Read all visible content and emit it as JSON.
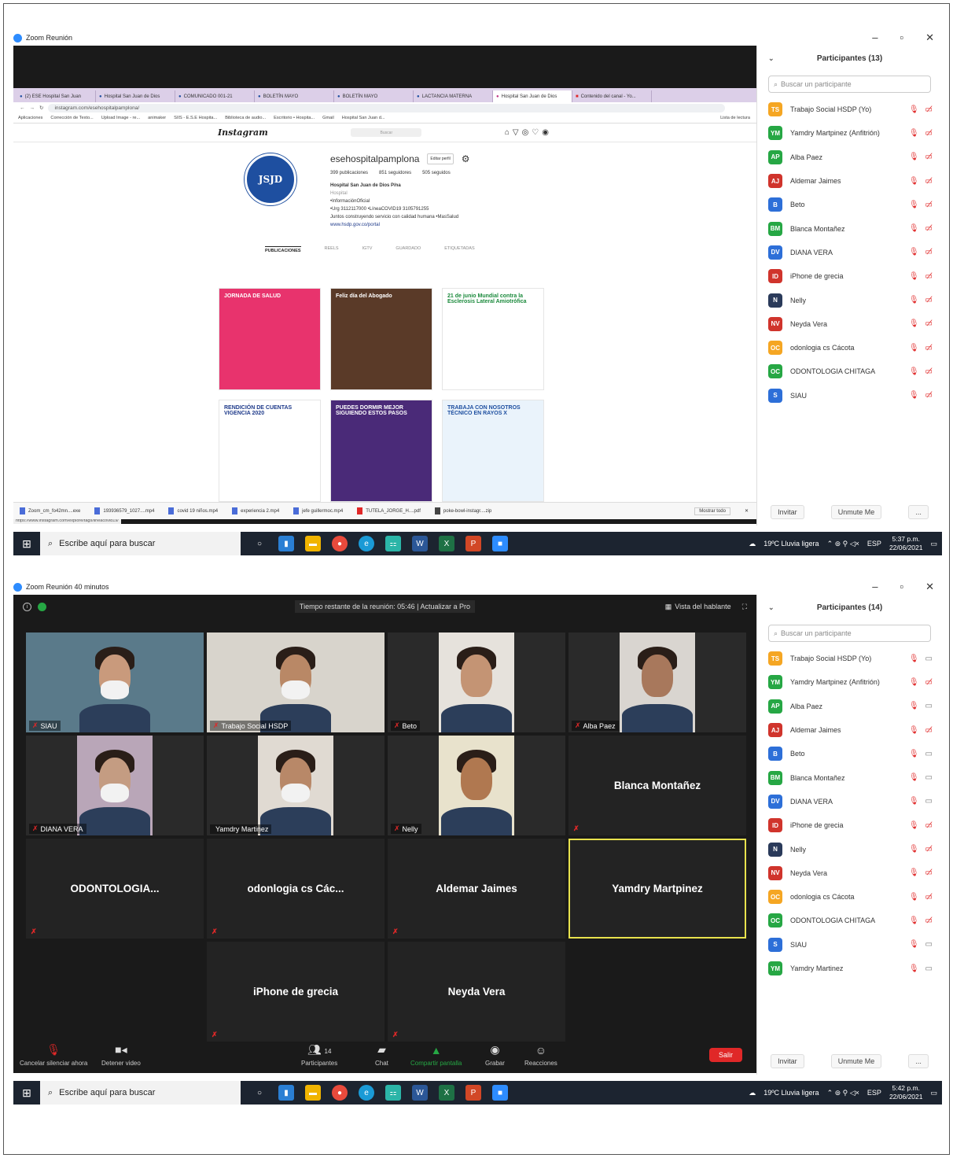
{
  "shot1": {
    "window_title": "Zoom Reunión",
    "browser": {
      "tabs": [
        "(2) ESE Hospital San Juan",
        "Hospital San Juan de Dios",
        "COMUNICADO 001-21",
        "BOLETÍN MAYO",
        "BOLETÍN MAYO",
        "LACTANCIA MATERNA",
        "Hospital San Juan de Dios",
        "Contenido del canal - Yo..."
      ],
      "url": "instagram.com/esehospitalpamplona/",
      "bookmarks": [
        "Aplicaciones",
        "Corrección de Texto...",
        "Upload Image - re...",
        "animaker",
        "SIIS - E.S.E Hospita...",
        "Biblioteca de audio...",
        "Escritorio • Hospita...",
        "Gmail",
        "Hospital San Juan d...",
        "Lista de lectura"
      ],
      "ig_logo": "Instagram",
      "ig_search": "Buscar",
      "profile": {
        "username": "esehospitalpamplona",
        "edit": "Editar perfil",
        "posts": "399 publicaciones",
        "followers": "851 seguidores",
        "following": "505 seguidos",
        "name": "Hospital San Juan de Dios P/na",
        "category": "Hospital",
        "line1": "•InformaciónOficial",
        "line2": "•Urg 3112117000 •LíneaCOVID19 3105791255",
        "line3": "Juntos construyendo servicio con calidad humana •MasSalud",
        "link": "www.hsdp.gov.co/portal",
        "logo_text": "JSJD"
      },
      "ig_tabs": [
        "PUBLICACIONES",
        "REELS",
        "IGTV",
        "GUARDADO",
        "ETIQUETADAS"
      ],
      "posts": [
        {
          "title": "JORNADA DE SALUD",
          "bg": "#e8336d",
          "fg": "#ffffff"
        },
        {
          "title": "Feliz día del Abogado",
          "bg": "#5a3a28",
          "fg": "#ffffff"
        },
        {
          "title": "21 de junio Mundial contra la Esclerosis Lateral Amiotrófica",
          "bg": "#ffffff",
          "fg": "#1b8a3c"
        },
        {
          "title": "RENDICIÓN DE CUENTAS VIGENCIA 2020",
          "bg": "#ffffff",
          "fg": "#1e3a8a"
        },
        {
          "title": "PUEDES DORMIR MEJOR SIGUIENDO ESTOS PASOS",
          "bg": "#4a2a78",
          "fg": "#ffffff"
        },
        {
          "title": "TRABAJA CON NOSOTROS TÉCNICO EN RAYOS X",
          "bg": "#eaf3fb",
          "fg": "#1e4fa0"
        }
      ],
      "status_url": "https://www.instagram.com/explore/tags/lineacovid19/",
      "downloads": [
        "Zoom_cm_fo42mn....exe",
        "193936579_1027....mp4",
        "covid 19 niños.mp4",
        "experiencia 2.mp4",
        "jefe guillermoc.mp4",
        "TUTELA_JORGE_H....pdf",
        "poke-bowl-instagr....zip"
      ],
      "show_all": "Mostrar todo"
    },
    "panel": {
      "title": "Participantes (13)",
      "search_placeholder": "Buscar un participante",
      "invite": "Invitar",
      "unmute": "Unmute Me",
      "more": "..."
    },
    "participants": [
      {
        "initials": "TS",
        "name": "Trabajo Social HSDP (Yo)",
        "color": "#f5a623"
      },
      {
        "initials": "YM",
        "name": "Yamdry Martpinez (Anfitrión)",
        "color": "#26a744"
      },
      {
        "initials": "AP",
        "name": "Alba Paez",
        "color": "#26a744"
      },
      {
        "initials": "AJ",
        "name": "Aldemar Jaimes",
        "color": "#d0342c"
      },
      {
        "initials": "B",
        "name": "Beto",
        "color": "#2d6fd8"
      },
      {
        "initials": "BM",
        "name": "Blanca Montañez",
        "color": "#26a744"
      },
      {
        "initials": "DV",
        "name": "DIANA VERA",
        "color": "#2d6fd8"
      },
      {
        "initials": "ID",
        "name": "iPhone de grecia",
        "color": "#d0342c"
      },
      {
        "initials": "N",
        "name": "Nelly",
        "color": "#2a3a5a"
      },
      {
        "initials": "NV",
        "name": "Neyda Vera",
        "color": "#d0342c"
      },
      {
        "initials": "OC",
        "name": "odonlogia cs Cácota",
        "color": "#f5a623"
      },
      {
        "initials": "OC",
        "name": "ODONTOLOGIA CHITAGA",
        "color": "#26a744"
      },
      {
        "initials": "S",
        "name": "SIAU",
        "color": "#2d6fd8"
      }
    ],
    "taskbar": {
      "search": "Escribe aquí para buscar",
      "weather": "19ºC  Lluvia ligera",
      "lang": "ESP",
      "time": "5:37 p.m.",
      "date": "22/06/2021"
    }
  },
  "shot2": {
    "window_title": "Zoom Reunión 40 minutos",
    "banner": "Tiempo restante de la reunión: 05:46 | Actualizar a Pro",
    "speaker_view": "Vista del hablante",
    "tiles": [
      {
        "label": "SIAU",
        "kind": "video",
        "skin": "#c99a7c",
        "bg": "#5a7a8a"
      },
      {
        "label": "Trabajo Social HSDP",
        "kind": "video",
        "skin": "#b98866",
        "bg": "#d8d4cc"
      },
      {
        "label": "Beto",
        "kind": "video",
        "skin": "#c49474",
        "bg": "#e6e2dc"
      },
      {
        "label": "Alba Paez",
        "kind": "video",
        "skin": "#a8785c",
        "bg": "#d9d5d0"
      },
      {
        "label": "DIANA VERA",
        "kind": "video",
        "skin": "#c49c82",
        "bg": "#b9a6b8"
      },
      {
        "label": "Yamdry Martinez",
        "kind": "video",
        "skin": "#b88868",
        "bg": "#e0dad2"
      },
      {
        "label": "Nelly",
        "kind": "video",
        "skin": "#b07850",
        "bg": "#e8e2cc"
      },
      {
        "label": "Blanca Montañez",
        "kind": "name"
      },
      {
        "label": "ODONTOLOGIA...",
        "kind": "name"
      },
      {
        "label": "odonlogia cs Các...",
        "kind": "name"
      },
      {
        "label": "Aldemar Jaimes",
        "kind": "name"
      },
      {
        "label": "Yamdry Martpinez",
        "kind": "name-active"
      },
      {
        "label": "",
        "kind": "empty"
      },
      {
        "label": "iPhone de grecia",
        "kind": "name"
      },
      {
        "label": "Neyda Vera",
        "kind": "name"
      },
      {
        "label": "",
        "kind": "empty"
      }
    ],
    "controls": {
      "mute": "Cancelar silenciar ahora",
      "video": "Detener video",
      "participants": "Participantes",
      "participants_count": "14",
      "chat": "Chat",
      "share": "Compartir pantalla",
      "record": "Grabar",
      "reactions": "Reacciones",
      "leave": "Salir"
    },
    "panel": {
      "title": "Participantes (14)",
      "search_placeholder": "Buscar un participante",
      "invite": "Invitar",
      "unmute": "Unmute Me",
      "more": "..."
    },
    "participants": [
      {
        "initials": "TS",
        "name": "Trabajo Social HSDP (Yo)",
        "color": "#f5a623",
        "video": true
      },
      {
        "initials": "YM",
        "name": "Yamdry Martpinez (Anfitrión)",
        "color": "#26a744",
        "video": false
      },
      {
        "initials": "AP",
        "name": "Alba Paez",
        "color": "#26a744",
        "video": true
      },
      {
        "initials": "AJ",
        "name": "Aldemar Jaimes",
        "color": "#d0342c",
        "video": false
      },
      {
        "initials": "B",
        "name": "Beto",
        "color": "#2d6fd8",
        "video": true
      },
      {
        "initials": "BM",
        "name": "Blanca Montañez",
        "color": "#26a744",
        "video": true
      },
      {
        "initials": "DV",
        "name": "DIANA VERA",
        "color": "#2d6fd8",
        "video": true
      },
      {
        "initials": "ID",
        "name": "iPhone de grecia",
        "color": "#d0342c",
        "video": false
      },
      {
        "initials": "N",
        "name": "Nelly",
        "color": "#2a3a5a",
        "video": false
      },
      {
        "initials": "NV",
        "name": "Neyda Vera",
        "color": "#d0342c",
        "video": false
      },
      {
        "initials": "OC",
        "name": "odonlogia cs Cácota",
        "color": "#f5a623",
        "video": false
      },
      {
        "initials": "OC",
        "name": "ODONTOLOGIA CHITAGA",
        "color": "#26a744",
        "video": false
      },
      {
        "initials": "S",
        "name": "SIAU",
        "color": "#2d6fd8",
        "video": true
      },
      {
        "initials": "YM",
        "name": "Yamdry Martinez",
        "color": "#26a744",
        "video": true
      }
    ],
    "taskbar": {
      "search": "Escribe aquí para buscar",
      "weather": "19ºC  Lluvia ligera",
      "lang": "ESP",
      "time": "5:42 p.m.",
      "date": "22/06/2021"
    }
  }
}
